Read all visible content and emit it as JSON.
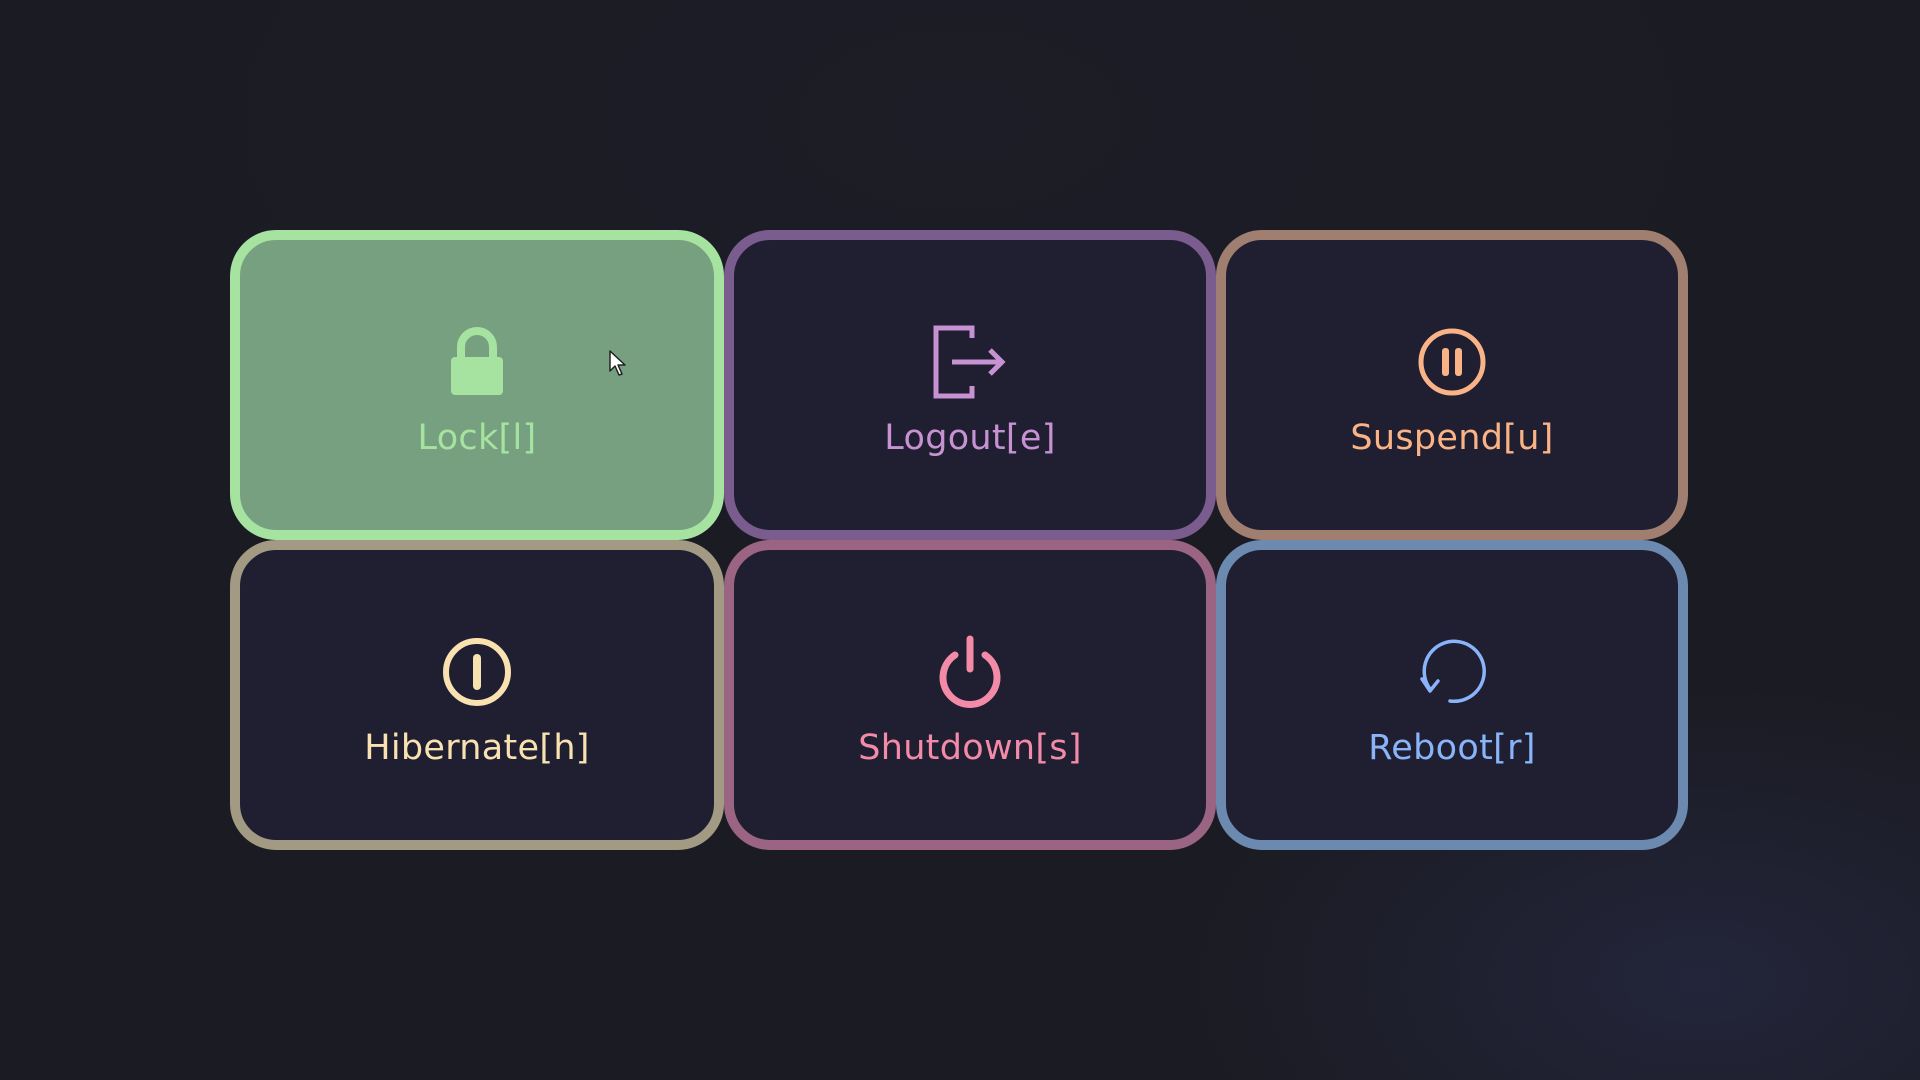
{
  "buttons": [
    {
      "id": "lock",
      "label": "Lock[l]",
      "icon": "lock-icon",
      "border": "#a6e3a1",
      "text": "#a6e3a1",
      "active": true
    },
    {
      "id": "logout",
      "label": "Logout[e]",
      "icon": "logout-icon",
      "border": "#7b5c8e",
      "text": "#c692d1",
      "active": false
    },
    {
      "id": "suspend",
      "label": "Suspend[u]",
      "icon": "pause-circle-icon",
      "border": "#a07f70",
      "text": "#fab387",
      "active": false
    },
    {
      "id": "hibernate",
      "label": "Hibernate[h]",
      "icon": "hibernate-icon",
      "border": "#a39a83",
      "text": "#f9e2af",
      "active": false
    },
    {
      "id": "shutdown",
      "label": "Shutdown[s]",
      "icon": "power-icon",
      "border": "#9c6483",
      "text": "#f38ba8",
      "active": false
    },
    {
      "id": "reboot",
      "label": "Reboot[r]",
      "icon": "reboot-icon",
      "border": "#6c8ab0",
      "text": "#89b4fa",
      "active": false
    }
  ],
  "colors": {
    "background": "#1b1b23",
    "tile_background": "#1f1f31",
    "active_tile_background": "#76a080"
  }
}
